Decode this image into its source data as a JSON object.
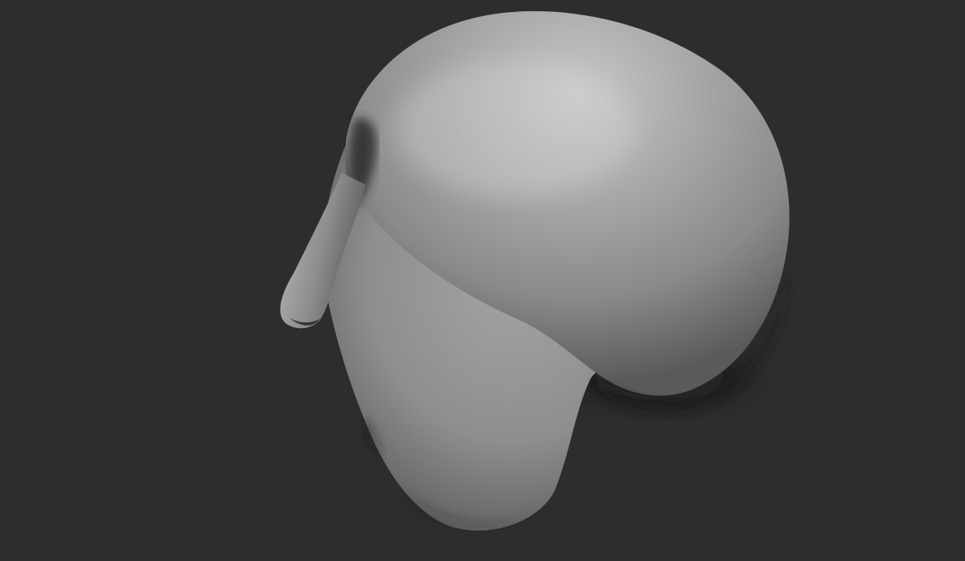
{
  "viewport": {
    "background_color": "#2d2d2d",
    "model": {
      "name": "sculpted-head-mesh",
      "material_color": "#9a9a9a",
      "highlight_color": "#c9c9c9",
      "shadow_color": "#3a3a3a"
    }
  }
}
